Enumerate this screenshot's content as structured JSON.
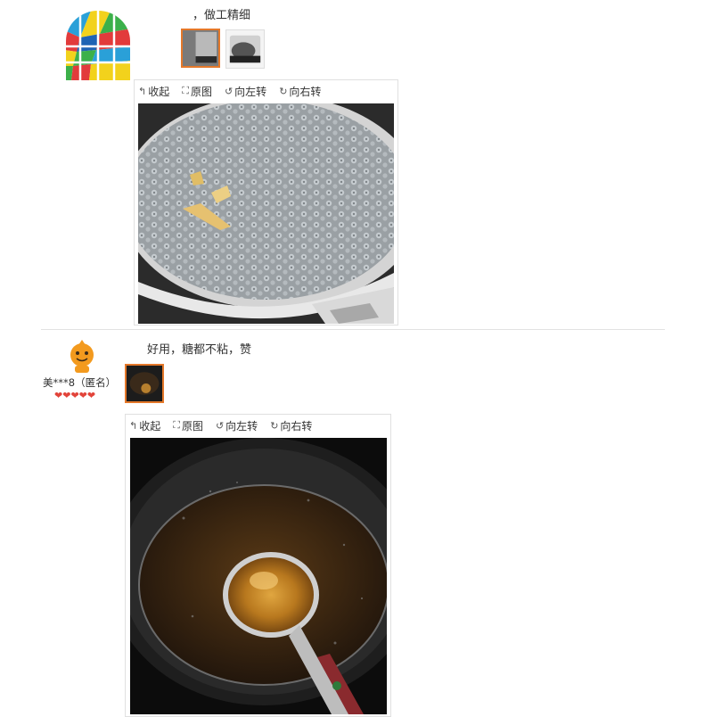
{
  "review1": {
    "text": "，做工精细"
  },
  "review2": {
    "text": "好用，糖都不粘，赞",
    "username": "美***8（匿名）",
    "rating": 5
  },
  "toolbar": {
    "collapse": "收起",
    "original": "原图",
    "rotate_left": "向左转",
    "rotate_right": "向右转"
  },
  "icons": {
    "collapse": "collapse-arrow-icon",
    "original": "expand-icon",
    "rotate_left": "rotate-left-icon",
    "rotate_right": "rotate-right-icon",
    "rating": "heart-icon"
  },
  "colors": {
    "accent": "#e4782a",
    "rating": "#e2443a",
    "divider": "#e2e2e2"
  }
}
